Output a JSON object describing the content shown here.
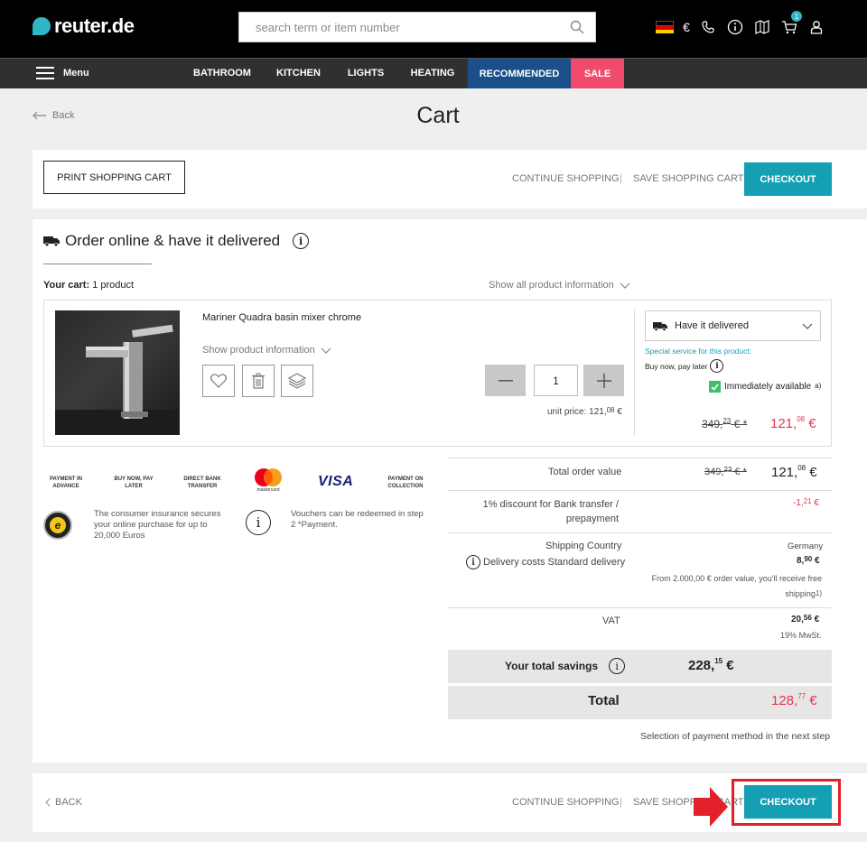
{
  "header": {
    "logo_text": "reuter.de",
    "search_placeholder": "search term or item number",
    "currency": "€",
    "cart_count": "1"
  },
  "nav": {
    "menu_label": "Menu",
    "items": [
      "BATHROOM",
      "KITCHEN",
      "LIGHTS",
      "HEATING",
      "RECOMMENDED",
      "SALE"
    ]
  },
  "page": {
    "back_label": "Back",
    "title": "Cart"
  },
  "actions": {
    "print_label": "PRINT SHOPPING CART",
    "continue_label": "CONTINUE SHOPPING",
    "separator": "|",
    "save_label": "SAVE SHOPPING CART",
    "checkout_label": "CHECKOUT"
  },
  "delivery_section": {
    "heading": "Order online & have it delivered",
    "your_cart_label": "Your cart:",
    "your_cart_count": "1 product",
    "show_all_label": "Show all product information"
  },
  "product": {
    "name": "Mariner Quadra basin mixer chrome",
    "show_info_label": "Show product information",
    "quantity": "1",
    "unit_price_label": "unit price: 121,",
    "unit_price_cents": "08",
    "unit_price_currency": " €",
    "delivery_option": "Have it delivered",
    "special_service": "Special service for this product:",
    "buy_now": "Buy now, pay later",
    "availability": "Immediately available",
    "availability_sup": "a)",
    "old_price": "349,",
    "old_price_cents": "23",
    "old_price_suffix": " € *",
    "price": "121,",
    "price_cents": "08",
    "price_currency": " €"
  },
  "payments": [
    "PAYMENT IN ADVANCE",
    "BUY NOW, PAY LATER",
    "DIRECT BANK TRANSFER",
    "mastercard",
    "VISA",
    "PAYMENT ON COLLECTION"
  ],
  "trust": {
    "insurance_text": "The consumer insurance secures your online purchase for up to 20,000 Euros",
    "voucher_text": "Vouchers can be redeemed in step 2 *Payment."
  },
  "summary": {
    "total_order_label": "Total order value",
    "total_order_old": "349,",
    "total_order_old_cents": "23",
    "total_order_old_suffix": " € *",
    "total_order_value": "121,",
    "total_order_cents": "08",
    "total_order_currency": " €",
    "discount_label": "1% discount for Bank transfer / prepayment",
    "discount_value": "-1,",
    "discount_cents": "21",
    "discount_currency": " €",
    "shipping_country_label": "Shipping Country",
    "shipping_country": "Germany",
    "delivery_costs_label": "Delivery costs Standard delivery",
    "delivery_costs": "8,",
    "delivery_costs_cents": "90",
    "delivery_costs_currency": " €",
    "free_shipping_note": "From 2.000,00 € order value, you'll receive free shipping",
    "free_shipping_sup": "1)",
    "vat_label": "VAT",
    "vat_value": "20,",
    "vat_cents": "56",
    "vat_currency": " €",
    "vat_rate": "19% MwSt.",
    "savings_label": "Your total savings",
    "savings_value": "228,",
    "savings_cents": "15",
    "savings_currency": " €",
    "total_label": "Total",
    "total_value": "128,",
    "total_cents": "77",
    "total_currency": " €",
    "payment_note": "Selection of payment method in the next step"
  },
  "footer": {
    "back_label": "BACK",
    "continue_label": "CONTINUE SHOPPING",
    "save_label": "SAVE SHOPPING CART",
    "checkout_label": "CHECKOUT"
  },
  "colors": {
    "teal": "#149fb4",
    "recommended": "#1b4f8a",
    "sale": "#f04b6c",
    "highlight": "#e2202a"
  }
}
